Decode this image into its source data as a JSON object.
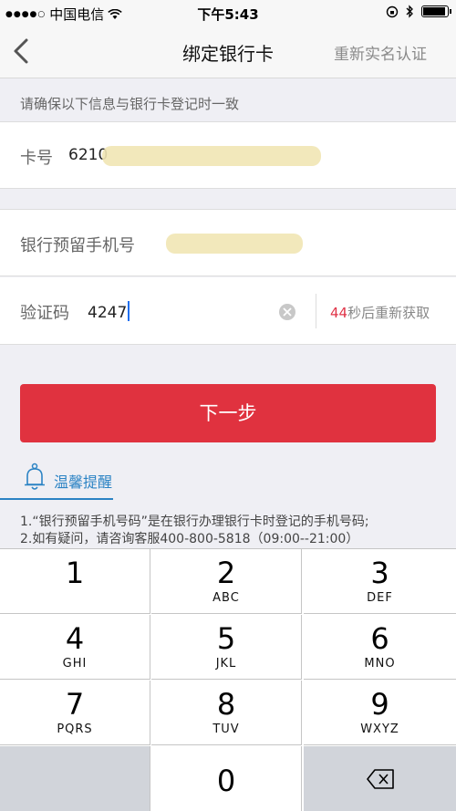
{
  "status": {
    "carrier": "中国电信",
    "time": "下午5:43"
  },
  "nav": {
    "title": "绑定银行卡",
    "action": "重新实名认证"
  },
  "notice": "请确保以下信息与银行卡登记时一致",
  "card": {
    "label": "卡号",
    "value_prefix": "6210"
  },
  "phone": {
    "label": "银行预留手机号"
  },
  "verify": {
    "label": "验证码",
    "value": "4247",
    "countdown_seconds": "44",
    "countdown_text": "秒后重新获取"
  },
  "next_button": "下一步",
  "tips": {
    "title": "温馨提醒",
    "lines": [
      "1.“银行预留手机号码”是在银行办理银行卡时登记的手机号码;",
      "2.如有疑问，请咨询客服400-800-5818（09:00--21:00）"
    ]
  },
  "keypad": {
    "keys": [
      {
        "num": "1",
        "letters": ""
      },
      {
        "num": "2",
        "letters": "ABC"
      },
      {
        "num": "3",
        "letters": "DEF"
      },
      {
        "num": "4",
        "letters": "GHI"
      },
      {
        "num": "5",
        "letters": "JKL"
      },
      {
        "num": "6",
        "letters": "MNO"
      },
      {
        "num": "7",
        "letters": "PQRS"
      },
      {
        "num": "8",
        "letters": "TUV"
      },
      {
        "num": "9",
        "letters": "WXYZ"
      },
      {
        "num": "0",
        "letters": ""
      }
    ]
  },
  "colors": {
    "accent_red": "#e0323f",
    "link_blue": "#2b83c4"
  }
}
